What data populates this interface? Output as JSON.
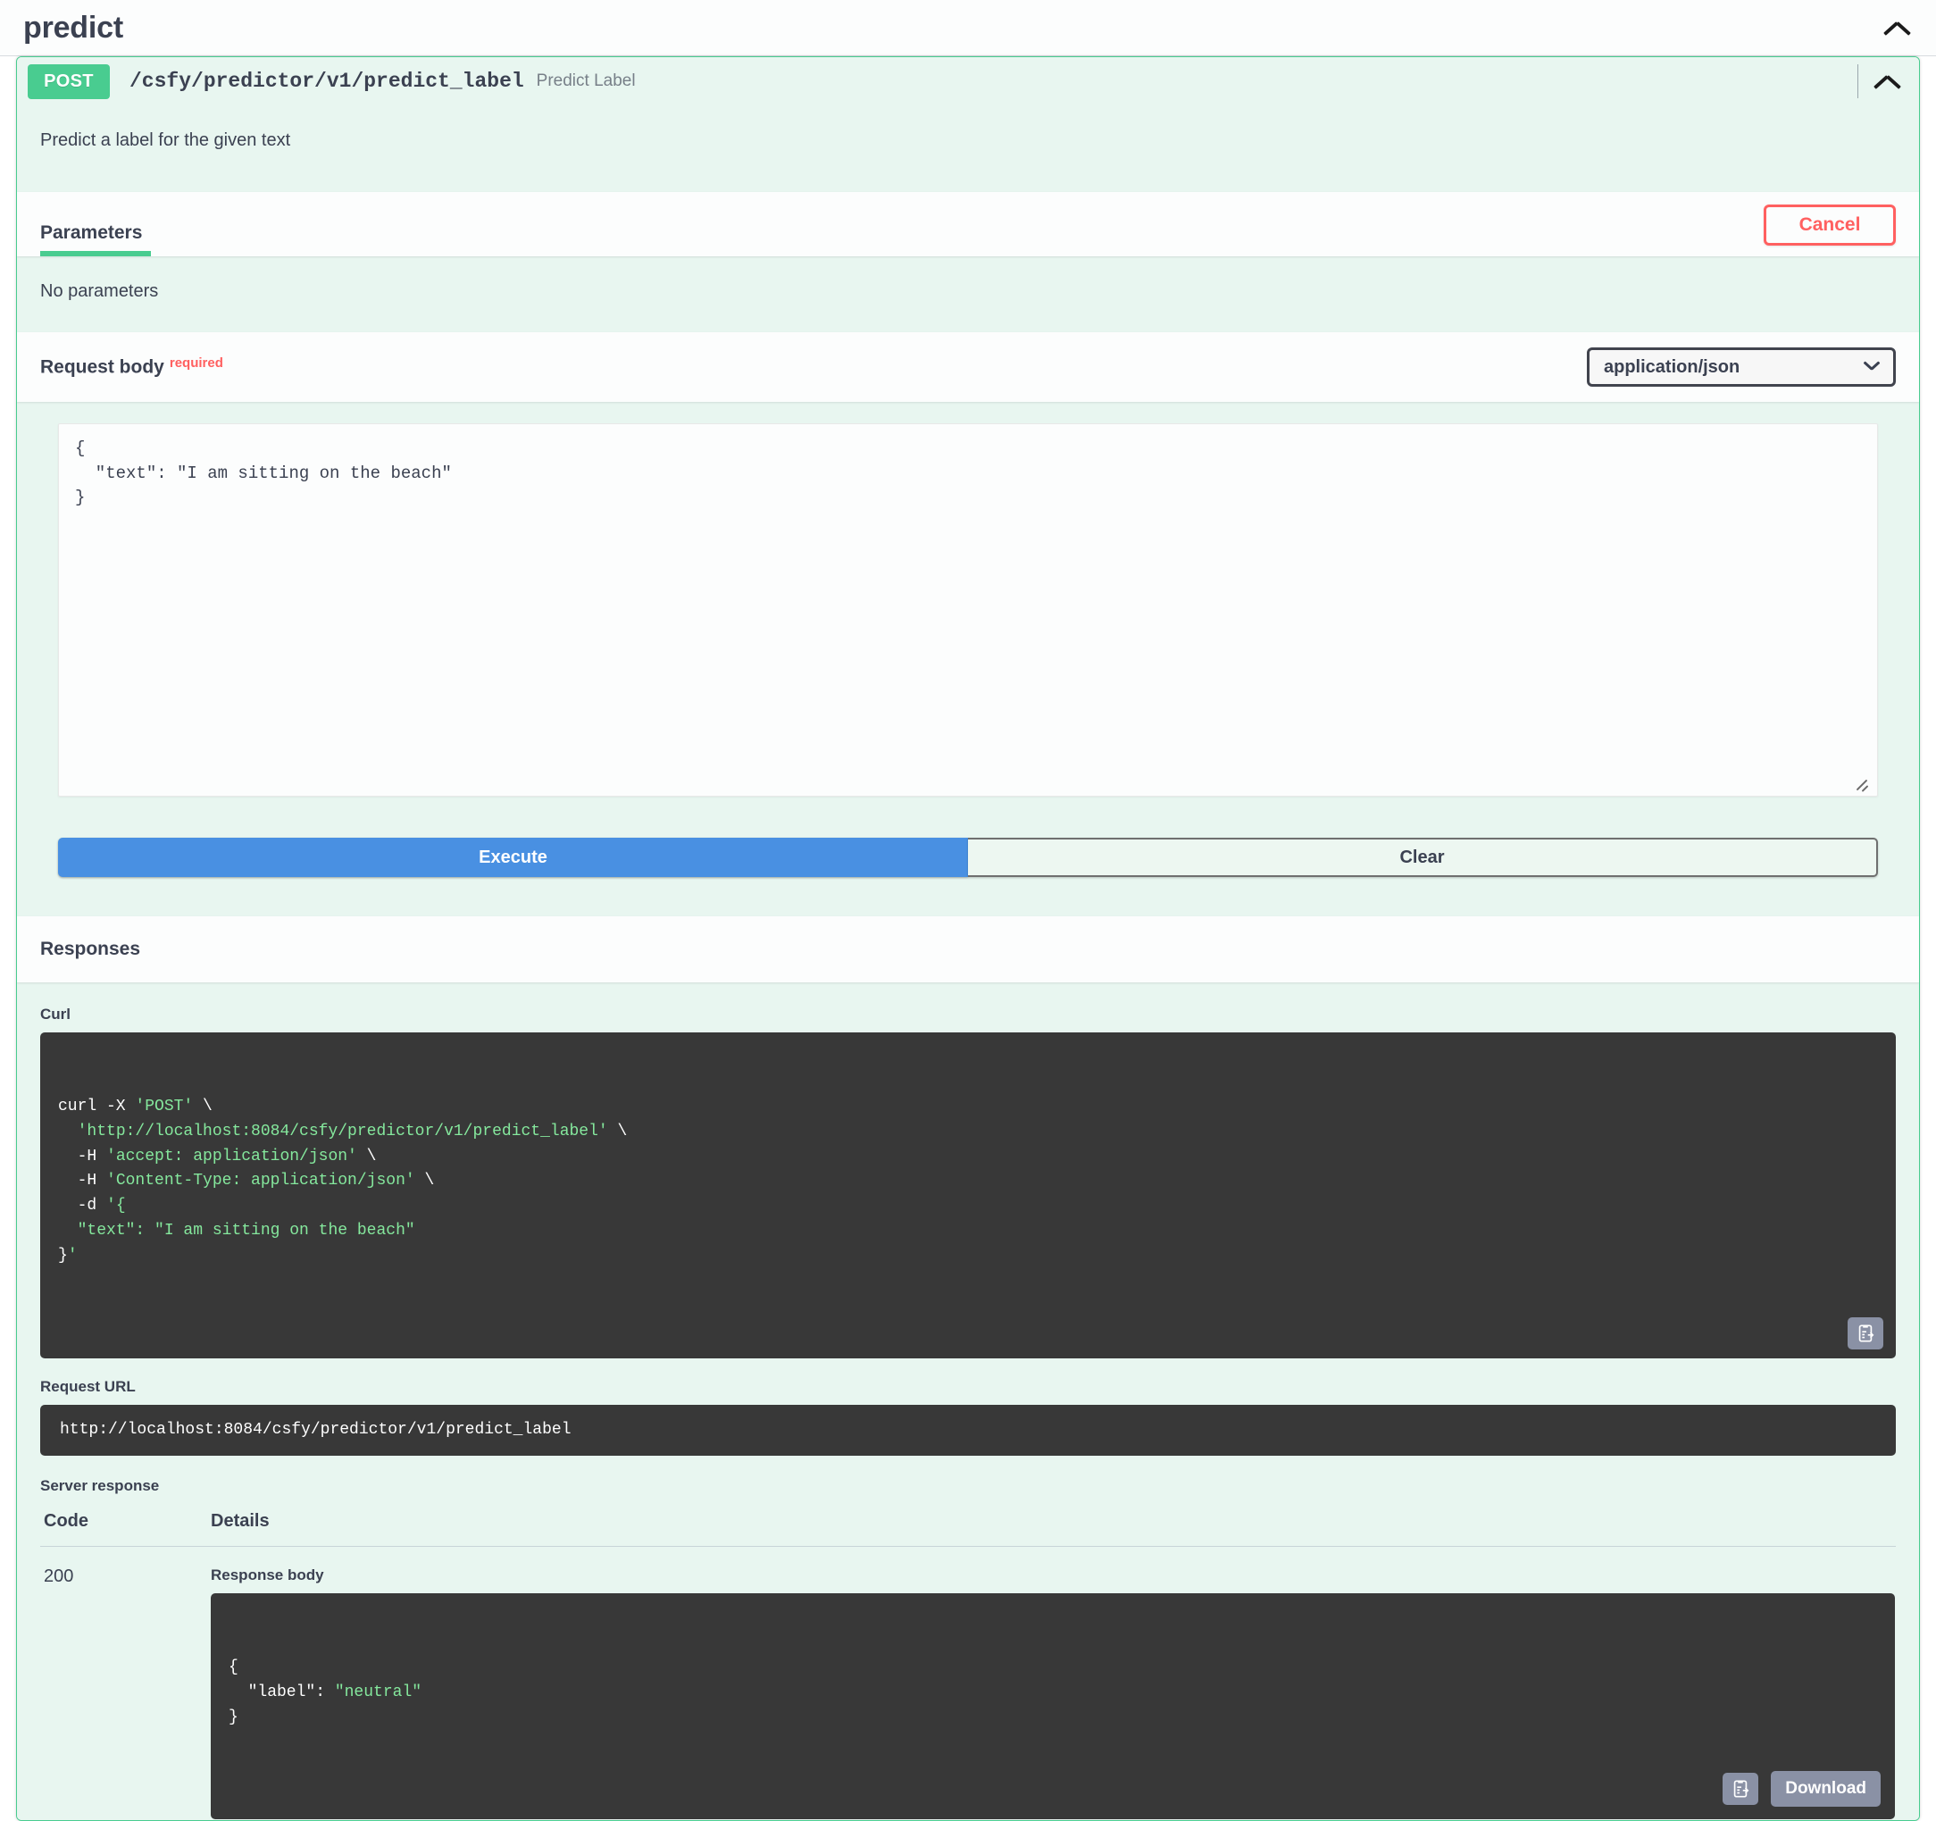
{
  "tag": {
    "title": "predict",
    "collapse_icon": "chevron-up-icon"
  },
  "operation": {
    "method": "POST",
    "path": "/csfy/predictor/v1/predict_label",
    "summary": "Predict Label",
    "description": "Predict a label for the given text",
    "collapse_icon": "chevron-up-icon"
  },
  "parameters": {
    "tab_label": "Parameters",
    "cancel_label": "Cancel",
    "empty_text": "No parameters"
  },
  "request_body": {
    "label": "Request body",
    "required_label": "required",
    "content_type": {
      "selected": "application/json",
      "options": [
        "application/json"
      ],
      "chevron_icon": "chevron-down-icon"
    },
    "editor_value": "{\n  \"text\": \"I am sitting on the beach\"\n}",
    "resize_icon": "resize-handle-icon"
  },
  "actions": {
    "execute_label": "Execute",
    "clear_label": "Clear"
  },
  "responses": {
    "title": "Responses",
    "curl": {
      "label": "Curl",
      "lines": [
        {
          "plain": "curl -X ",
          "green": "'POST'",
          "tail": " \\"
        },
        {
          "plain": "  ",
          "green": "'http://localhost:8084/csfy/predictor/v1/predict_label'",
          "tail": " \\"
        },
        {
          "plain": "  -H ",
          "green": "'accept: application/json'",
          "tail": " \\"
        },
        {
          "plain": "  -H ",
          "green": "'Content-Type: application/json'",
          "tail": " \\"
        },
        {
          "plain": "  -d ",
          "green": "'{",
          "tail": ""
        },
        {
          "plain": "  ",
          "green": "\"text\": \"I am sitting on the beach\"",
          "tail": ""
        },
        {
          "plain": "}",
          "green": "'",
          "tail": ""
        }
      ],
      "copy_icon": "copy-to-clipboard-icon"
    },
    "request_url": {
      "label": "Request URL",
      "value": "http://localhost:8084/csfy/predictor/v1/predict_label"
    },
    "server_response": {
      "label": "Server response",
      "columns": [
        "Code",
        "Details"
      ],
      "rows": [
        {
          "code": "200",
          "details_label": "Response body",
          "body_lines": [
            {
              "plain": "{",
              "green": "",
              "tail": ""
            },
            {
              "plain": "  \"label\": ",
              "green": "\"neutral\"",
              "tail": ""
            },
            {
              "plain": "}",
              "green": "",
              "tail": ""
            }
          ],
          "copy_icon": "copy-to-clipboard-icon",
          "download_label": "Download"
        }
      ]
    }
  },
  "colors": {
    "method_post": "#49cc90",
    "block_border": "#49cc90",
    "block_bg": "#e8f6f0",
    "cancel": "#ff6060",
    "execute": "#4990e2",
    "code_bg": "#383838",
    "code_green": "#85e89d",
    "required": "#ff6060"
  }
}
